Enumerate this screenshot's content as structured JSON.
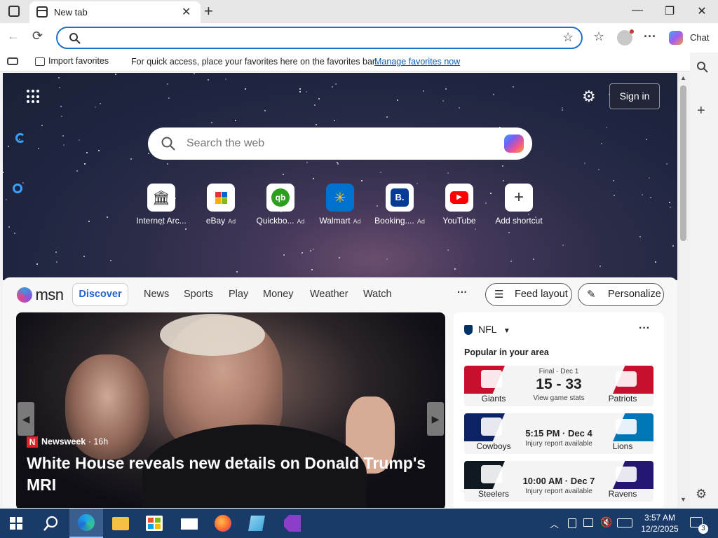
{
  "window": {
    "tab_title": "New tab"
  },
  "favorites_bar": {
    "import_label": "Import favorites",
    "message": "For quick access, place your favorites here on the favorites bar.",
    "manage_link": "Manage favorites now"
  },
  "toolbar": {
    "chat_label": "Chat"
  },
  "hero": {
    "sign_in_label": "Sign in",
    "search_placeholder": "Search the web",
    "shortcuts": [
      {
        "label": "Internet Arc...",
        "ad": "",
        "icon": "internet-archive-icon"
      },
      {
        "label": "eBay",
        "ad": "Ad",
        "icon": "ebay-icon"
      },
      {
        "label": "Quickbo...",
        "ad": "Ad",
        "icon": "quickbooks-icon"
      },
      {
        "label": "Walmart",
        "ad": "Ad",
        "icon": "walmart-icon"
      },
      {
        "label": "Booking....",
        "ad": "Ad",
        "icon": "booking-icon"
      },
      {
        "label": "YouTube",
        "ad": "",
        "icon": "youtube-icon"
      },
      {
        "label": "Add shortcut",
        "ad": "",
        "icon": "plus-icon"
      }
    ]
  },
  "feed": {
    "brand": "msn",
    "nav": [
      "Discover",
      "News",
      "Sports",
      "Play",
      "Money",
      "Weather",
      "Watch"
    ],
    "more": "···",
    "feed_layout_label": "Feed layout",
    "personalize_label": "Personalize",
    "headline": {
      "source": "Newsweek",
      "age": "· 16h",
      "title": "White House reveals new details on Donald Trump's MRI"
    },
    "nfl": {
      "title": "NFL",
      "subtitle": "Popular in your area",
      "games": [
        {
          "home": "Giants",
          "away": "Patriots",
          "status": "Final · Dec 1",
          "score": "15 - 33",
          "detail": "View game stats",
          "home_color": "#c8102e",
          "away_color": "#c8102e"
        },
        {
          "home": "Cowboys",
          "away": "Lions",
          "status": "",
          "score": "5:15 PM · Dec 4",
          "detail": "Injury report available",
          "home_color": "#0b2265",
          "away_color": "#0076b6"
        },
        {
          "home": "Steelers",
          "away": "Ravens",
          "status": "",
          "score": "10:00 AM · Dec 7",
          "detail": "Injury report available",
          "home_color": "#101820",
          "away_color": "#241773"
        }
      ]
    }
  },
  "taskbar": {
    "time": "3:57 AM",
    "date": "12/2/2025",
    "notification_count": "3"
  }
}
